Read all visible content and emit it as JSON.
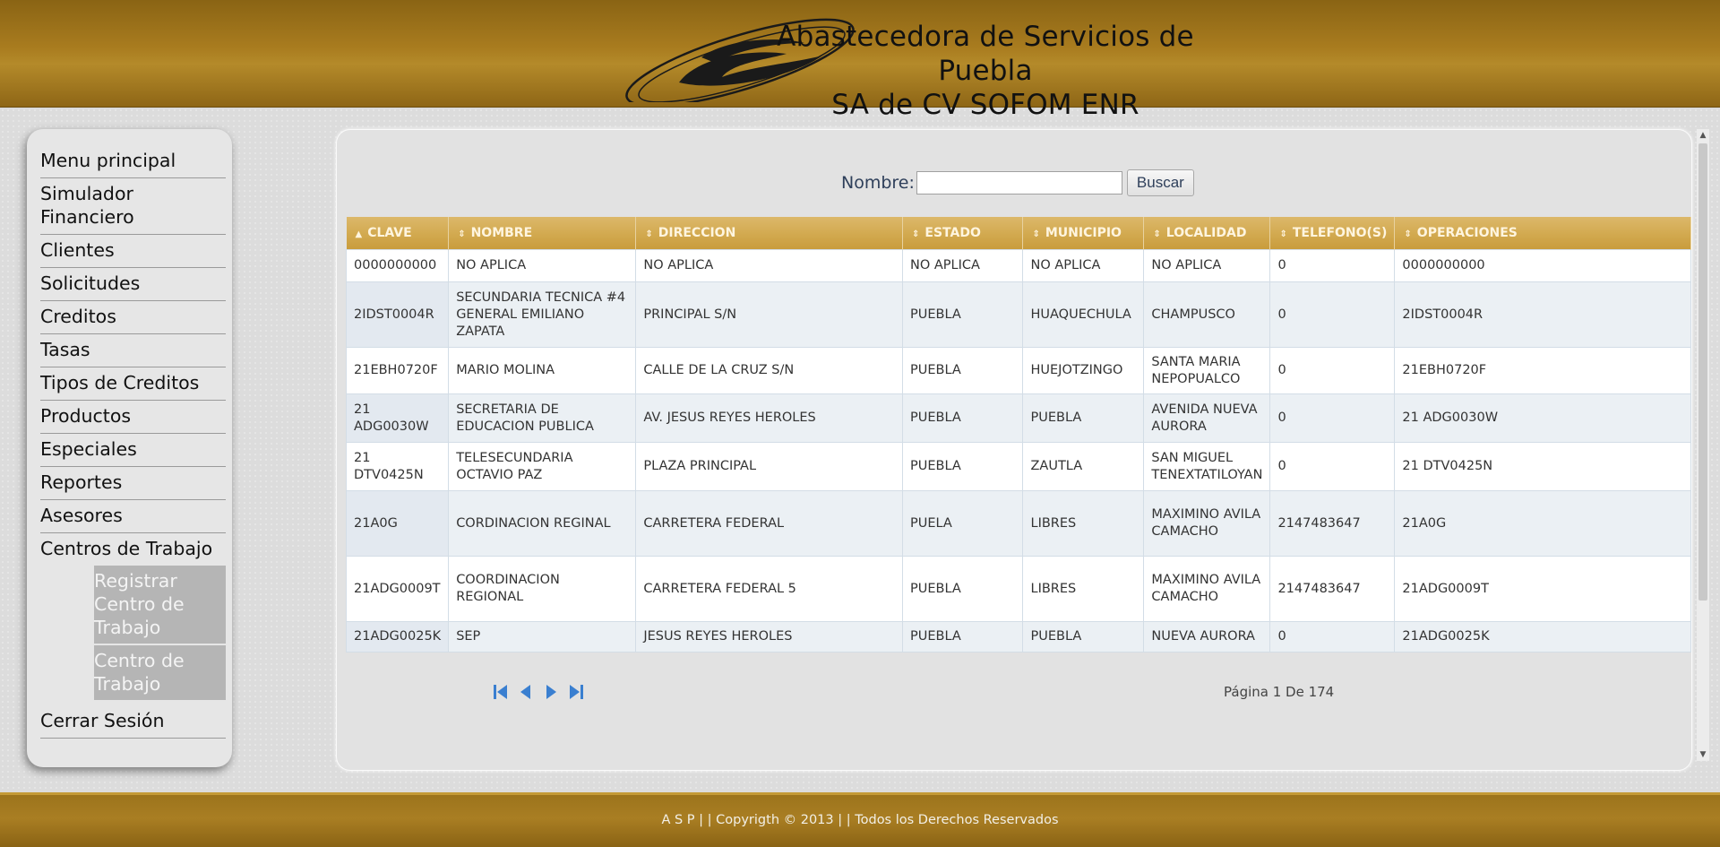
{
  "header": {
    "title_line1": "Abastecedora de Servicios de Puebla",
    "title_line2": "SA de CV SOFOM ENR"
  },
  "sidebar": {
    "items": [
      {
        "label": "Menu principal"
      },
      {
        "label": "Simulador Financiero"
      },
      {
        "label": "Clientes"
      },
      {
        "label": "Solicitudes"
      },
      {
        "label": "Creditos"
      },
      {
        "label": "Tasas"
      },
      {
        "label": "Tipos de Creditos"
      },
      {
        "label": "Productos"
      },
      {
        "label": "Especiales"
      },
      {
        "label": "Reportes"
      },
      {
        "label": "Asesores"
      },
      {
        "label": "Centros de Trabajo"
      }
    ],
    "subitems": [
      {
        "label": "Registrar Centro de Trabajo"
      },
      {
        "label": "Centro de Trabajo"
      }
    ],
    "logout": "Cerrar Sesión"
  },
  "search": {
    "label": "Nombre:",
    "value": "",
    "button": "Buscar"
  },
  "table": {
    "columns": [
      "CLAVE",
      "NOMBRE",
      "DIRECCION",
      "ESTADO",
      "MUNICIPIO",
      "LOCALIDAD",
      "TELEFONO(S)",
      "OPERACIONES"
    ],
    "rows": [
      [
        "0000000000",
        "NO APLICA",
        "NO APLICA",
        "NO APLICA",
        "NO APLICA",
        "NO APLICA",
        "0",
        "0000000000"
      ],
      [
        "2IDST0004R",
        "SECUNDARIA TECNICA #4 GENERAL EMILIANO ZAPATA",
        "PRINCIPAL S/N",
        "PUEBLA",
        "HUAQUECHULA",
        "CHAMPUSCO",
        "0",
        "2IDST0004R"
      ],
      [
        "21EBH0720F",
        "MARIO MOLINA",
        "CALLE DE LA CRUZ S/N",
        "PUEBLA",
        "HUEJOTZINGO",
        "SANTA MARIA NEPOPUALCO",
        "0",
        "21EBH0720F"
      ],
      [
        "21 ADG0030W",
        "SECRETARIA DE EDUCACION PUBLICA",
        "AV. JESUS REYES HEROLES",
        "PUEBLA",
        "PUEBLA",
        "AVENIDA NUEVA AURORA",
        "0",
        "21 ADG0030W"
      ],
      [
        "21 DTV0425N",
        "TELESECUNDARIA OCTAVIO PAZ",
        "PLAZA PRINCIPAL",
        "PUEBLA",
        "ZAUTLA",
        "SAN MIGUEL TENEXTATILOYAN",
        "0",
        "21 DTV0425N"
      ],
      [
        "21A0G",
        "CORDINACION REGINAL",
        "CARRETERA FEDERAL",
        "PUELA",
        "LIBRES",
        "MAXIMINO AVILA CAMACHO",
        "2147483647",
        "21A0G"
      ],
      [
        "21ADG0009T",
        "COORDINACION REGIONAL",
        "CARRETERA FEDERAL 5",
        "PUEBLA",
        "LIBRES",
        "MAXIMINO AVILA CAMACHO",
        "2147483647",
        "21ADG0009T"
      ],
      [
        "21ADG0025K",
        "SEP",
        "JESUS REYES HEROLES",
        "PUEBLA",
        "PUEBLA",
        "NUEVA AURORA",
        "0",
        "21ADG0025K"
      ]
    ]
  },
  "pager": {
    "icons": [
      "first-page-icon",
      "previous-page-icon",
      "next-page-icon",
      "last-page-icon"
    ],
    "info": "Página 1 De 174"
  },
  "footer": {
    "text": "A S P | | Copyrigth © 2013 | | Todos los Derechos Reservados"
  },
  "colors": {
    "header_gold": "#a97c1f",
    "table_header": "#d2a94f",
    "sidebar_bg": "#e6e6e6",
    "submenu_bg": "#b5b5b5",
    "pager_blue": "#3a7fd0"
  }
}
